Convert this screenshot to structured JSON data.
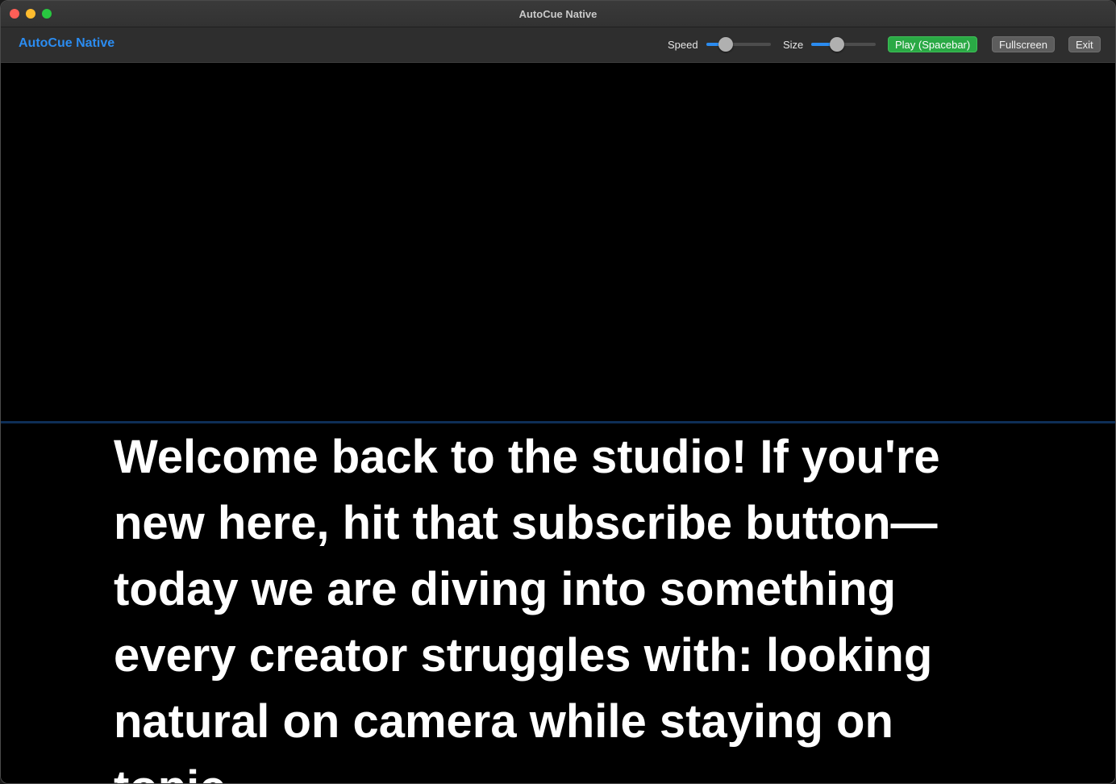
{
  "window": {
    "title": "AutoCue Native"
  },
  "toolbar": {
    "app_name": "AutoCue Native",
    "speed": {
      "label": "Speed",
      "value_fraction": 0.24
    },
    "size": {
      "label": "Size",
      "value_fraction": 0.37
    },
    "play_label": "Play (Spacebar)",
    "fullscreen_label": "Fullscreen",
    "exit_label": "Exit"
  },
  "script": {
    "text": "Welcome back to the studio! If you're new here, hit that subscribe button—today we are diving into something every creator struggles with: looking natural on camera while staying on topic."
  },
  "colors": {
    "accent": "#2b8cf0",
    "play_button": "#2aa945",
    "background": "#000000",
    "reading_line": "#0e2e56"
  },
  "icons": {
    "close": "close-icon",
    "minimize": "minimize-icon",
    "maximize": "maximize-icon"
  }
}
